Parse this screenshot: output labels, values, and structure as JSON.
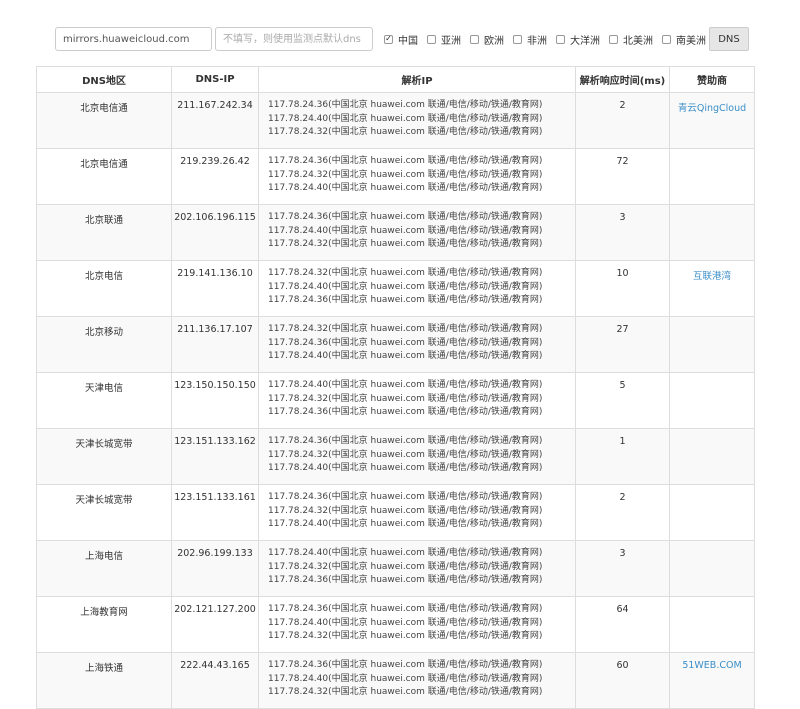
{
  "toolbar": {
    "domain_value": "mirrors.huaweicloud.com",
    "dns_placeholder": "不填写，则使用监测点默认dns",
    "regions": [
      {
        "label": "中国",
        "checked": true
      },
      {
        "label": "亚洲",
        "checked": false
      },
      {
        "label": "欧洲",
        "checked": false
      },
      {
        "label": "非洲",
        "checked": false
      },
      {
        "label": "大洋洲",
        "checked": false
      },
      {
        "label": "北美洲",
        "checked": false
      },
      {
        "label": "南美洲",
        "checked": false
      }
    ],
    "dns_button": "DNS"
  },
  "table": {
    "headers": [
      "DNS地区",
      "DNS-IP",
      "解析IP",
      "解析响应时间(ms)",
      "赞助商"
    ],
    "rows": [
      {
        "region": "北京电信通",
        "dns_ip": "211.167.242.34",
        "ips": [
          "117.78.24.36",
          "117.78.24.40",
          "117.78.24.32"
        ],
        "time": "2",
        "sponsor": "青云QingCloud"
      },
      {
        "region": "北京电信通",
        "dns_ip": "219.239.26.42",
        "ips": [
          "117.78.24.36",
          "117.78.24.32",
          "117.78.24.40"
        ],
        "time": "72",
        "sponsor": ""
      },
      {
        "region": "北京联通",
        "dns_ip": "202.106.196.115",
        "ips": [
          "117.78.24.36",
          "117.78.24.40",
          "117.78.24.32"
        ],
        "time": "3",
        "sponsor": ""
      },
      {
        "region": "北京电信",
        "dns_ip": "219.141.136.10",
        "ips": [
          "117.78.24.32",
          "117.78.24.40",
          "117.78.24.36"
        ],
        "time": "10",
        "sponsor": "互联港湾"
      },
      {
        "region": "北京移动",
        "dns_ip": "211.136.17.107",
        "ips": [
          "117.78.24.32",
          "117.78.24.36",
          "117.78.24.40"
        ],
        "time": "27",
        "sponsor": ""
      },
      {
        "region": "天津电信",
        "dns_ip": "123.150.150.150",
        "ips": [
          "117.78.24.40",
          "117.78.24.32",
          "117.78.24.36"
        ],
        "time": "5",
        "sponsor": ""
      },
      {
        "region": "天津长城宽带",
        "dns_ip": "123.151.133.162",
        "ips": [
          "117.78.24.36",
          "117.78.24.32",
          "117.78.24.40"
        ],
        "time": "1",
        "sponsor": ""
      },
      {
        "region": "天津长城宽带",
        "dns_ip": "123.151.133.161",
        "ips": [
          "117.78.24.36",
          "117.78.24.32",
          "117.78.24.40"
        ],
        "time": "2",
        "sponsor": ""
      },
      {
        "region": "上海电信",
        "dns_ip": "202.96.199.133",
        "ips": [
          "117.78.24.40",
          "117.78.24.32",
          "117.78.24.36"
        ],
        "time": "3",
        "sponsor": ""
      },
      {
        "region": "上海教育网",
        "dns_ip": "202.121.127.200",
        "ips": [
          "117.78.24.36",
          "117.78.24.40",
          "117.78.24.32"
        ],
        "time": "64",
        "sponsor": ""
      },
      {
        "region": "上海铁通",
        "dns_ip": "222.44.43.165",
        "ips": [
          "117.78.24.36",
          "117.78.24.40",
          "117.78.24.32"
        ],
        "time": "60",
        "sponsor": "51WEB.COM"
      }
    ],
    "ip_suffix": "(中国北京 huawei.com 联通/电信/移动/铁通/教育网)"
  }
}
